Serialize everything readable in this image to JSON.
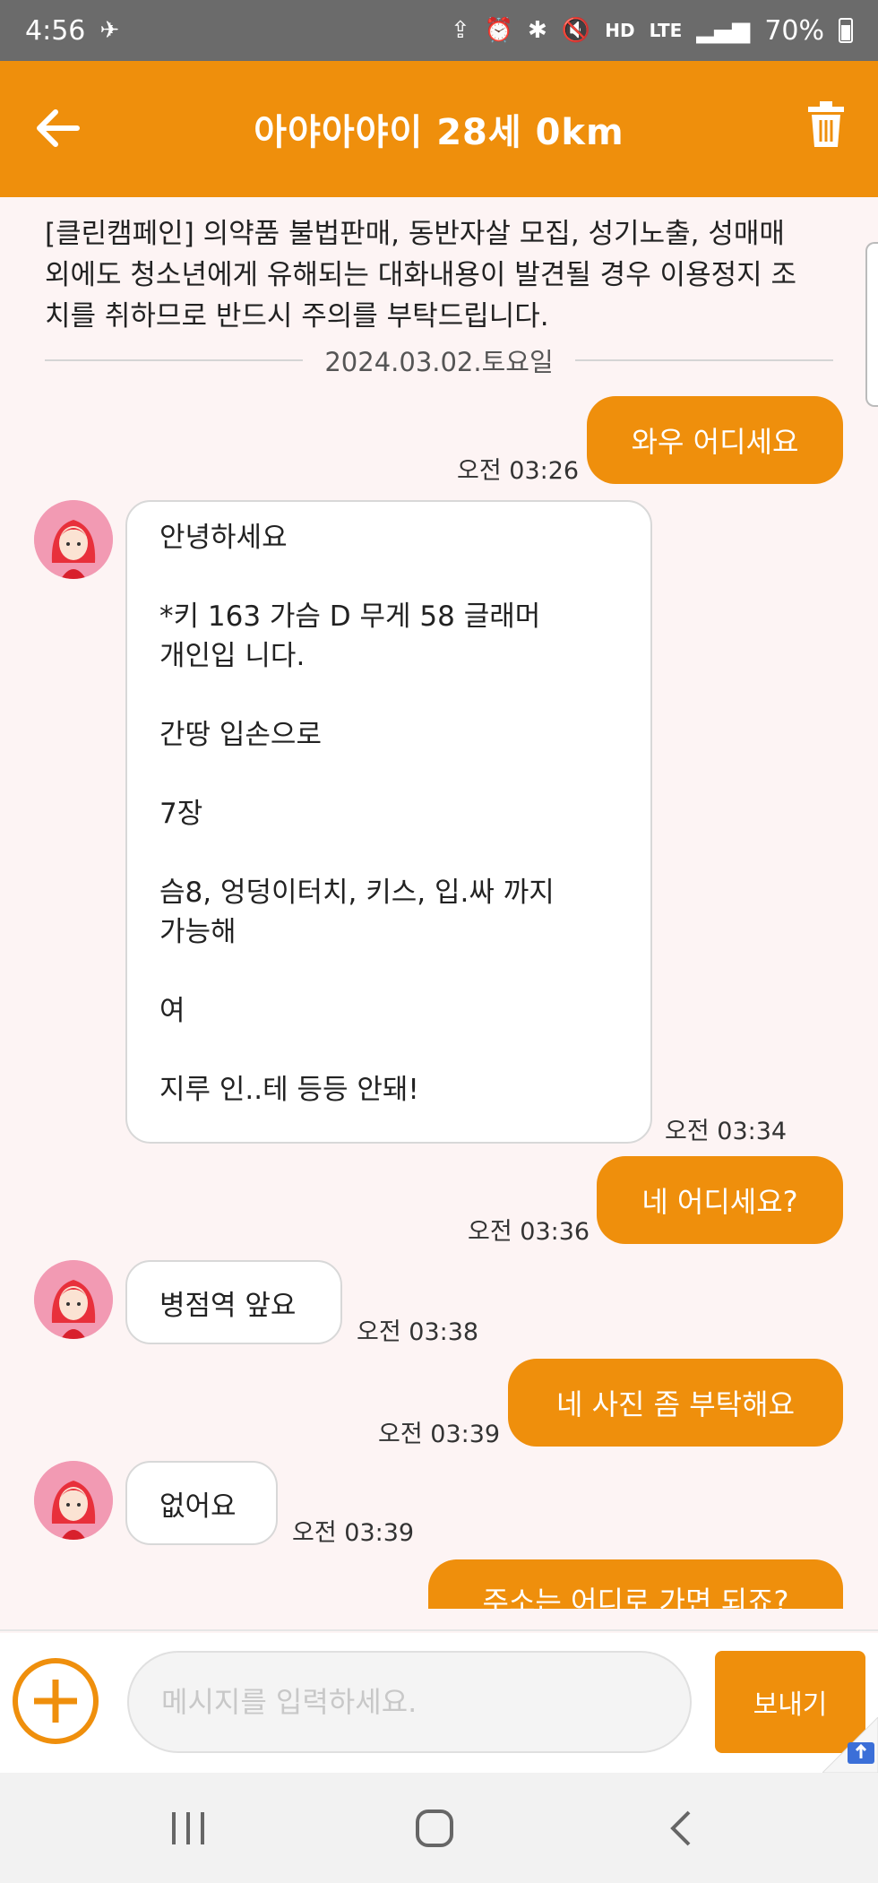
{
  "status_bar": {
    "time": "4:56",
    "network": "HD",
    "lte": "LTE",
    "battery": "70%"
  },
  "header": {
    "title": "아야아야이 28세 0km",
    "back_icon": "arrow-left-icon",
    "delete_icon": "trash-icon"
  },
  "notice": "[클린캠페인] 의약품 불법판매, 동반자살 모집, 성기노출, 성매매 외에도 청소년에게 유해되는 대화내용이 발견될 경우 이용정지 조치를 취하므로 반드시 주의를 부탁드립니다.",
  "date_separator": "2024.03.02.토요일",
  "messages": [
    {
      "direction": "out",
      "text": "와우 어디세요",
      "time": "오전 03:26"
    },
    {
      "direction": "in",
      "paragraphs": [
        "안녕하세요",
        "*키 163 가슴 D 무게 58 글래머\n개인입 니다.",
        "간땅 입손으로",
        "7장",
        "슴8, 엉덩이터치, 키스, 입.싸 까지\n가능해",
        "여",
        "지루 인..테 등등 안돼!"
      ],
      "time": "오전 03:34"
    },
    {
      "direction": "out",
      "text": "네 어디세요?",
      "time": "오전 03:36"
    },
    {
      "direction": "in",
      "text": "병점역 앞요",
      "time": "오전 03:38"
    },
    {
      "direction": "out",
      "text": "네 사진 좀 부탁해요",
      "time": "오전 03:39"
    },
    {
      "direction": "in",
      "text": "없어요",
      "time": "오전 03:39"
    },
    {
      "direction": "out",
      "text": "주소는 어디로 가면 되죠?",
      "time": ""
    }
  ],
  "composer": {
    "placeholder": "메시지를 입력하세요.",
    "send_label": "보내기"
  },
  "colors": {
    "accent": "#ef8f0c",
    "background": "#fdf4f4",
    "status_bar": "#6b6b6b"
  }
}
